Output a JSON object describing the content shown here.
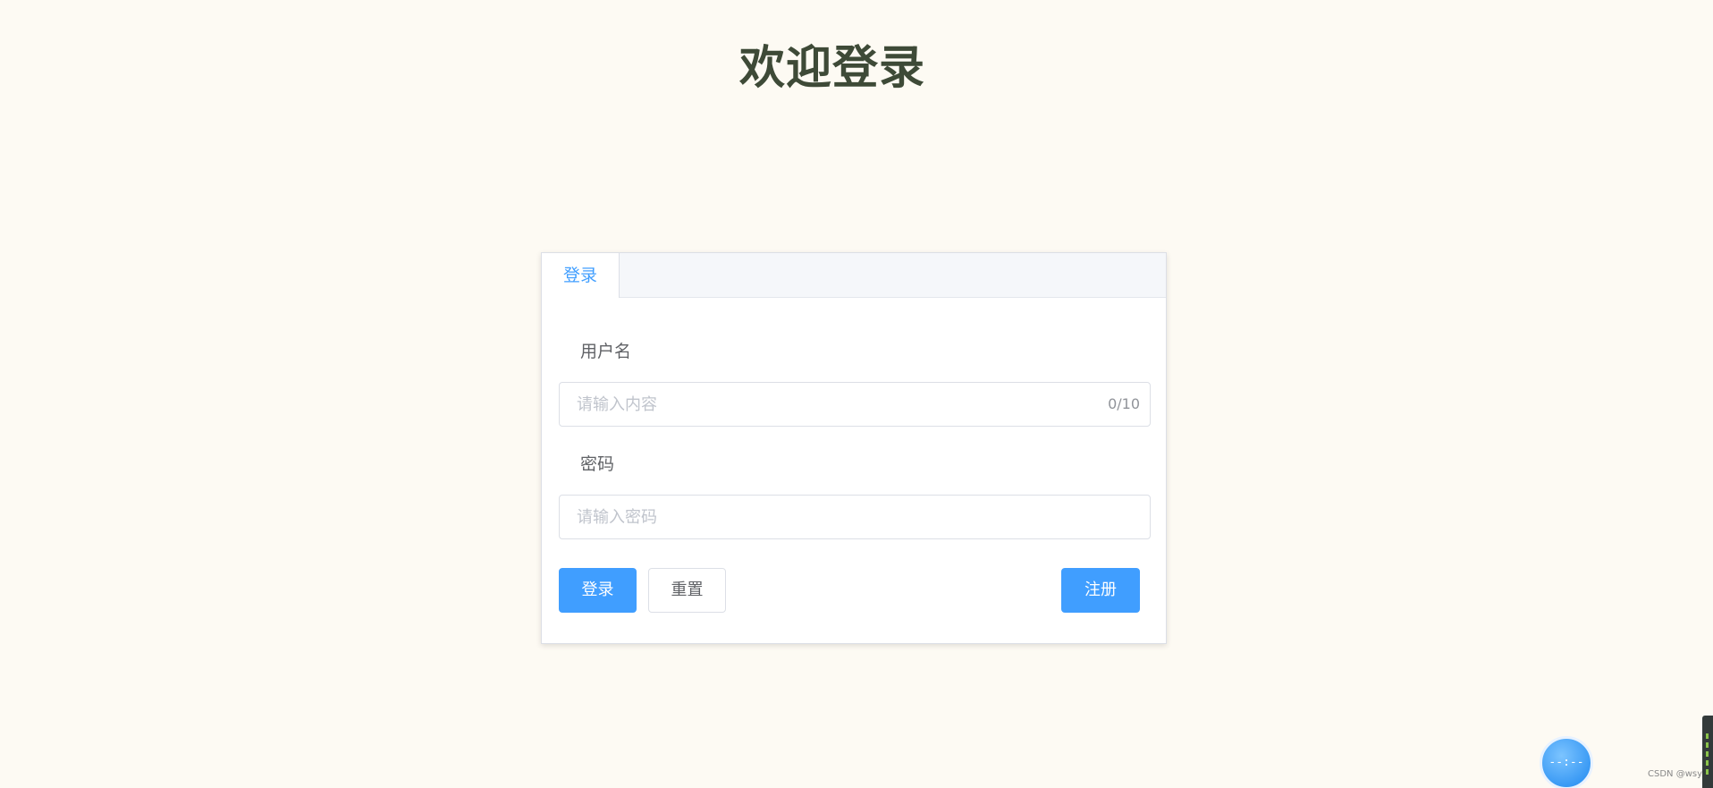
{
  "page": {
    "title": "欢迎登录"
  },
  "tabs": [
    {
      "label": "登录",
      "active": true
    }
  ],
  "form": {
    "username": {
      "label": "用户名",
      "value": "",
      "placeholder": "请输入内容",
      "counter": "0/10"
    },
    "password": {
      "label": "密码",
      "value": "",
      "placeholder": "请输入密码"
    }
  },
  "buttons": {
    "login": "登录",
    "reset": "重置",
    "register": "注册"
  },
  "float_widget": {
    "text": "--:--",
    "icon": "timer-icon"
  },
  "watermark": "CSDN @wsy",
  "colors": {
    "primary": "#409eff",
    "title": "#3e4a37",
    "background": "#fdfaf3"
  }
}
